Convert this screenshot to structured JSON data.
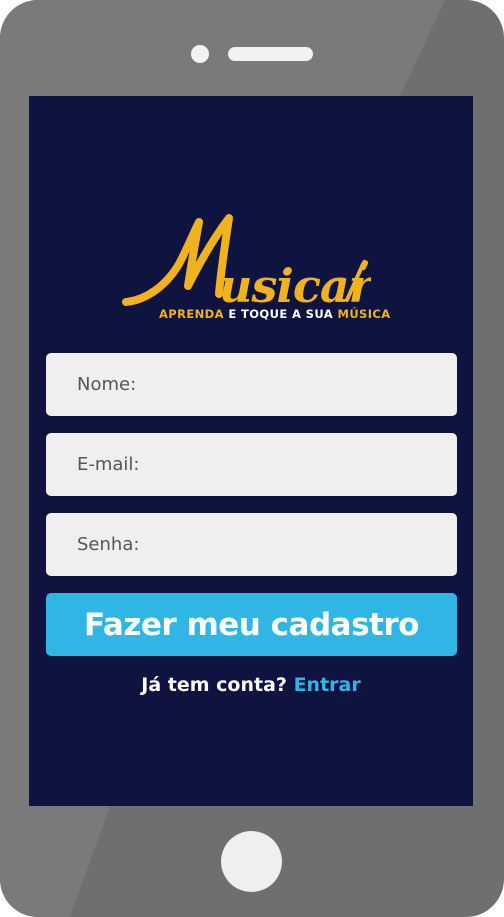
{
  "colors": {
    "phone_body": "#6f6f6f",
    "screen_background": "#0e1340",
    "field_background": "#efefef",
    "accent": "#30b6e4",
    "logo_gold": "#f0b21e"
  },
  "logo": {
    "wordmark": "Musicar",
    "tagline_part1": "APRENDA",
    "tagline_part2": " E TOQUE A SUA ",
    "tagline_part3": "MÚSICA"
  },
  "form": {
    "name_placeholder": "Nome:",
    "email_placeholder": "E-mail:",
    "password_placeholder": "Senha:",
    "submit_label": "Fazer meu cadastro"
  },
  "footer": {
    "prompt": "Já tem conta?",
    "link_label": "Entrar"
  },
  "icons": {
    "speaker": "speaker-icon",
    "camera": "camera-dot-icon",
    "home": "home-button-icon",
    "guitar_pick": "guitar-neck-icon"
  }
}
